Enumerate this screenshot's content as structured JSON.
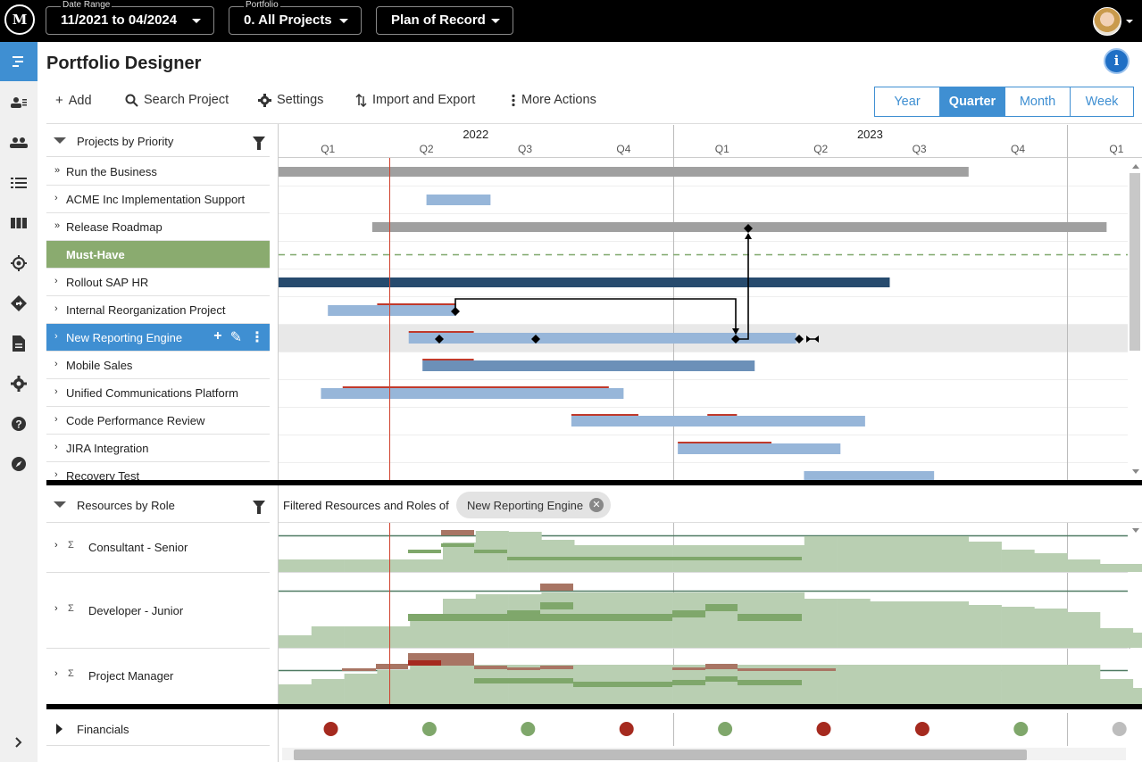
{
  "topbar": {
    "date_range": {
      "caption": "Date Range",
      "value": "11/2021 to 04/2024"
    },
    "portfolio": {
      "caption": "Portfolio",
      "value": "0. All Projects"
    },
    "plan": {
      "value": "Plan of Record"
    },
    "logo_icon": "mm-logo",
    "avatar_icon": "user-avatar"
  },
  "sidebar": {
    "icons": [
      "portfolio-designer-icon",
      "resources-icon",
      "team-icon",
      "list-icon",
      "board-icon",
      "target-icon",
      "direction-icon",
      "document-icon",
      "gear-icon",
      "help-icon",
      "compass-icon",
      "expand-chevron-icon"
    ]
  },
  "page": {
    "title": "Portfolio Designer"
  },
  "toolbar": {
    "add": "Add",
    "search": "Search Project",
    "settings": "Settings",
    "import_export": "Import and Export",
    "more": "More Actions"
  },
  "view_toggle": [
    "Year",
    "Quarter",
    "Month",
    "Week"
  ],
  "view_toggle_selected": "Quarter",
  "projects_header": "Projects by Priority",
  "timeline": {
    "years": [
      "2022",
      "2023"
    ],
    "quarters": [
      "Q1",
      "Q2",
      "Q3",
      "Q4",
      "Q1",
      "Q2",
      "Q3",
      "Q4",
      "Q1"
    ]
  },
  "projects": [
    {
      "name": "Run the Business",
      "arrow": "»",
      "start": 0.0,
      "end": 7.0,
      "color": "#a0a0a0"
    },
    {
      "name": "ACME Inc Implementation Support",
      "arrow": "›",
      "start": 1.5,
      "end": 2.15,
      "color": "#97b6d9"
    },
    {
      "name": "Release Roadmap",
      "arrow": "»",
      "start": 0.95,
      "end": 8.4,
      "color": "#a0a0a0"
    },
    {
      "name": "Must-Have",
      "group": true
    },
    {
      "name": "Rollout SAP HR",
      "arrow": "›",
      "start": 0.0,
      "end": 6.2,
      "color": "#274b6e"
    },
    {
      "name": "Internal Reorganization Project",
      "arrow": "›",
      "start": 0.5,
      "end": 1.8,
      "color": "#97b6d9"
    },
    {
      "name": "New Reporting Engine",
      "arrow": "›",
      "start": 1.32,
      "end": 5.25,
      "color": "#97b6d9",
      "selected": true
    },
    {
      "name": "Mobile Sales",
      "arrow": "›",
      "start": 1.46,
      "end": 4.83,
      "color": "#6c90b8"
    },
    {
      "name": "Unified Communications Platform",
      "arrow": "›",
      "start": 0.43,
      "end": 3.5,
      "color": "#97b6d9"
    },
    {
      "name": "Code Performance Review",
      "arrow": "›",
      "start": 2.97,
      "end": 5.95,
      "color": "#97b6d9"
    },
    {
      "name": "JIRA Integration",
      "arrow": "›",
      "start": 4.05,
      "end": 5.7,
      "color": "#97b6d9"
    },
    {
      "name": "Recovery Test",
      "arrow": "›",
      "start": 5.33,
      "end": 6.65,
      "color": "#97b6d9"
    }
  ],
  "resources_header": "Resources by Role",
  "filtered_label": "Filtered Resources and Roles of",
  "filter_chip": "New Reporting Engine",
  "resources": [
    {
      "name": "Consultant - Senior"
    },
    {
      "name": "Developer - Junior"
    },
    {
      "name": "Project Manager"
    }
  ],
  "financials": {
    "label": "Financials",
    "statuses": [
      "red",
      "green",
      "green",
      "red",
      "green",
      "red",
      "red",
      "green",
      "gray"
    ]
  },
  "colors": {
    "accent": "#3f8fd2",
    "group": "#8aab6f",
    "red": "#a52a1f",
    "green": "#7fa76b",
    "gray": "#bdbdbd",
    "today": "#d0402c"
  }
}
